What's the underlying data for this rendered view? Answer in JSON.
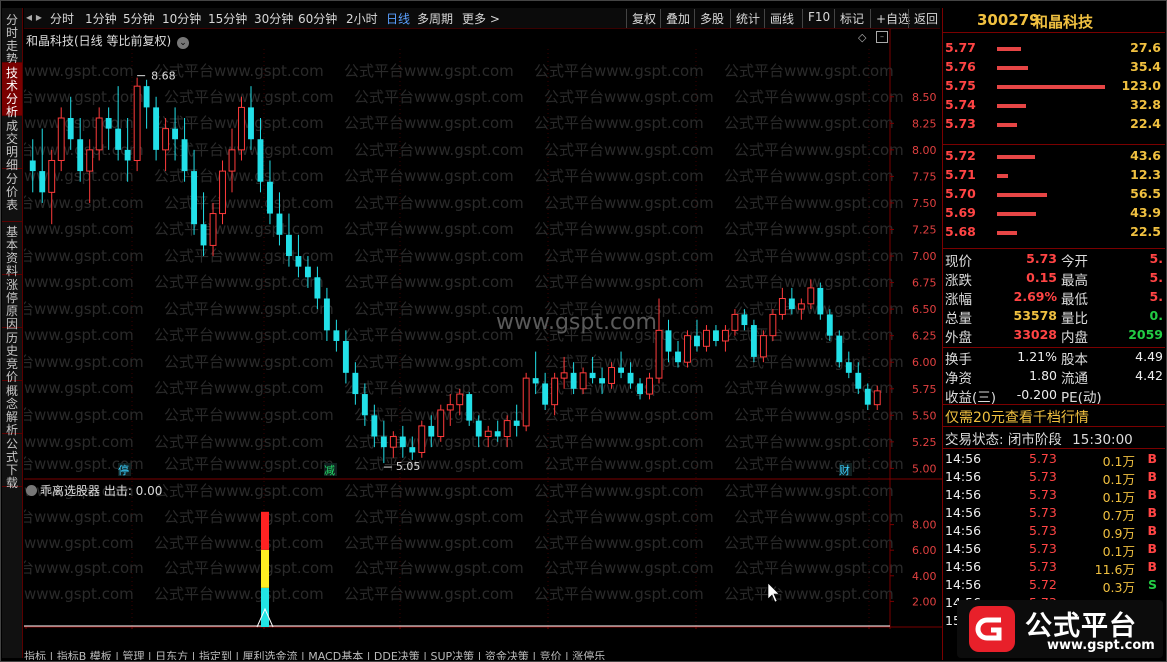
{
  "left_tabs": [
    {
      "label": "分时走势",
      "active": false
    },
    {
      "label": "技术分析",
      "active": true
    },
    {
      "label": "成交明细",
      "active": false
    },
    {
      "label": "分价表",
      "active": false
    },
    {
      "label": "基本资料",
      "active": false
    },
    {
      "label": "涨停原因",
      "active": false
    },
    {
      "label": "历史竞价",
      "active": false
    },
    {
      "label": "概念解析",
      "active": false
    },
    {
      "label": "公式下载",
      "active": false
    }
  ],
  "toolbar": {
    "periods": [
      "分时",
      "1分钟",
      "5分钟",
      "10分钟",
      "15分钟",
      "30分钟",
      "60分钟",
      "2小时",
      "日线",
      "多周期",
      "更多 >"
    ],
    "active_period": "日线",
    "actions": [
      "复权",
      "叠加",
      "多股",
      "统计",
      "画线",
      "F10",
      "标记",
      "+自选",
      "返回"
    ]
  },
  "chart": {
    "title": "和晶科技(日线 等比前复权)",
    "watermark": "www.gspt.com",
    "watermark_repeat": "公式平台www.gspt.com",
    "high_label": "8.68",
    "low_label": "5.05",
    "price_axis": [
      "8.50",
      "8.25",
      "8.00",
      "7.75",
      "7.50",
      "7.25",
      "7.00",
      "6.75",
      "6.50",
      "6.25",
      "6.00",
      "5.75",
      "5.50",
      "5.25",
      "5.00"
    ],
    "events": [
      "停",
      "减",
      "财"
    ],
    "indicator_title": "乖离选股器 出击: 0.00",
    "indicator_axis": [
      "8.00",
      "6.00",
      "4.00",
      "2.00"
    ],
    "date_labels": [
      "2022年",
      "4",
      "5",
      "6",
      "7",
      "8",
      "9"
    ],
    "period_label": "日线"
  },
  "chart_data": {
    "type": "candlestick",
    "title": "和晶科技(日线 等比前复权)",
    "ylim": [
      4.9,
      8.95
    ],
    "high": 8.68,
    "low": 5.05,
    "ohlc": [
      [
        7.9,
        8.1,
        7.6,
        7.8
      ],
      [
        7.8,
        8.2,
        7.5,
        7.6
      ],
      [
        7.6,
        8.0,
        7.3,
        7.9
      ],
      [
        7.9,
        8.4,
        7.8,
        8.3
      ],
      [
        8.3,
        8.5,
        8.0,
        8.1
      ],
      [
        8.1,
        8.3,
        7.7,
        7.8
      ],
      [
        7.8,
        8.1,
        7.5,
        8.0
      ],
      [
        8.0,
        8.4,
        7.9,
        8.3
      ],
      [
        8.3,
        8.4,
        8.0,
        8.2
      ],
      [
        8.2,
        8.6,
        7.9,
        8.0
      ],
      [
        8.0,
        8.3,
        7.7,
        7.9
      ],
      [
        7.9,
        8.68,
        7.8,
        8.6
      ],
      [
        8.6,
        8.66,
        8.2,
        8.4
      ],
      [
        8.4,
        8.5,
        7.9,
        8.0
      ],
      [
        8.0,
        8.3,
        7.8,
        8.2
      ],
      [
        8.2,
        8.4,
        7.9,
        8.1
      ],
      [
        8.1,
        8.3,
        7.7,
        7.8
      ],
      [
        7.8,
        8.0,
        7.2,
        7.3
      ],
      [
        7.3,
        7.6,
        7.0,
        7.1
      ],
      [
        7.1,
        7.5,
        7.0,
        7.4
      ],
      [
        7.4,
        7.9,
        7.3,
        7.8
      ],
      [
        7.8,
        8.2,
        7.6,
        8.0
      ],
      [
        8.0,
        8.5,
        7.9,
        8.4
      ],
      [
        8.4,
        8.6,
        8.0,
        8.1
      ],
      [
        8.1,
        8.3,
        7.6,
        7.7
      ],
      [
        7.7,
        7.9,
        7.3,
        7.4
      ],
      [
        7.4,
        7.6,
        7.1,
        7.2
      ],
      [
        7.2,
        7.4,
        6.9,
        7.0
      ],
      [
        7.0,
        7.2,
        6.8,
        6.9
      ],
      [
        6.9,
        7.0,
        6.7,
        6.8
      ],
      [
        6.8,
        6.9,
        6.5,
        6.6
      ],
      [
        6.6,
        6.7,
        6.2,
        6.3
      ],
      [
        6.3,
        6.4,
        6.1,
        6.2
      ],
      [
        6.2,
        6.3,
        5.8,
        5.9
      ],
      [
        5.9,
        6.0,
        5.6,
        5.7
      ],
      [
        5.7,
        5.8,
        5.4,
        5.5
      ],
      [
        5.5,
        5.6,
        5.2,
        5.3
      ],
      [
        5.3,
        5.45,
        5.05,
        5.2
      ],
      [
        5.2,
        5.35,
        5.1,
        5.3
      ],
      [
        5.3,
        5.4,
        5.1,
        5.2
      ],
      [
        5.2,
        5.3,
        5.08,
        5.15
      ],
      [
        5.15,
        5.45,
        5.1,
        5.4
      ],
      [
        5.4,
        5.5,
        5.2,
        5.3
      ],
      [
        5.3,
        5.6,
        5.25,
        5.55
      ],
      [
        5.55,
        5.7,
        5.4,
        5.6
      ],
      [
        5.6,
        5.75,
        5.5,
        5.7
      ],
      [
        5.7,
        5.72,
        5.4,
        5.45
      ],
      [
        5.45,
        5.5,
        5.2,
        5.3
      ],
      [
        5.3,
        5.4,
        5.2,
        5.35
      ],
      [
        5.35,
        5.45,
        5.25,
        5.3
      ],
      [
        5.3,
        5.5,
        5.2,
        5.45
      ],
      [
        5.45,
        5.6,
        5.3,
        5.4
      ],
      [
        5.4,
        5.9,
        5.35,
        5.85
      ],
      [
        5.85,
        6.1,
        5.7,
        5.8
      ],
      [
        5.8,
        5.9,
        5.55,
        5.6
      ],
      [
        5.6,
        5.9,
        5.5,
        5.85
      ],
      [
        5.85,
        6.05,
        5.75,
        5.9
      ],
      [
        5.9,
        6.0,
        5.7,
        5.75
      ],
      [
        5.75,
        5.95,
        5.7,
        5.9
      ],
      [
        5.9,
        6.05,
        5.8,
        5.85
      ],
      [
        5.85,
        5.95,
        5.7,
        5.8
      ],
      [
        5.8,
        6.0,
        5.75,
        5.95
      ],
      [
        5.95,
        6.1,
        5.85,
        5.9
      ],
      [
        5.9,
        6.0,
        5.75,
        5.8
      ],
      [
        5.8,
        5.85,
        5.65,
        5.7
      ],
      [
        5.7,
        5.9,
        5.65,
        5.85
      ],
      [
        5.85,
        6.6,
        5.8,
        6.3
      ],
      [
        6.3,
        6.4,
        6.0,
        6.1
      ],
      [
        6.1,
        6.2,
        5.95,
        6.0
      ],
      [
        6.0,
        6.3,
        5.95,
        6.25
      ],
      [
        6.25,
        6.4,
        6.1,
        6.15
      ],
      [
        6.15,
        6.35,
        6.1,
        6.3
      ],
      [
        6.3,
        6.35,
        6.15,
        6.2
      ],
      [
        6.2,
        6.35,
        6.1,
        6.3
      ],
      [
        6.3,
        6.5,
        6.25,
        6.45
      ],
      [
        6.45,
        6.5,
        6.3,
        6.35
      ],
      [
        6.35,
        6.4,
        6.0,
        6.05
      ],
      [
        6.05,
        6.3,
        6.0,
        6.25
      ],
      [
        6.25,
        6.5,
        6.2,
        6.45
      ],
      [
        6.45,
        6.7,
        6.4,
        6.6
      ],
      [
        6.6,
        6.7,
        6.45,
        6.5
      ],
      [
        6.5,
        6.6,
        6.4,
        6.55
      ],
      [
        6.55,
        6.78,
        6.5,
        6.7
      ],
      [
        6.7,
        6.75,
        6.4,
        6.45
      ],
      [
        6.45,
        6.5,
        6.2,
        6.25
      ],
      [
        6.25,
        6.3,
        5.95,
        6.0
      ],
      [
        6.0,
        6.1,
        5.85,
        5.9
      ],
      [
        5.9,
        6.0,
        5.7,
        5.75
      ],
      [
        5.75,
        5.8,
        5.55,
        5.6
      ],
      [
        5.6,
        5.78,
        5.55,
        5.73
      ]
    ]
  },
  "indicator_bar": {
    "value": 9.0,
    "segments": [
      {
        "color": "#ff2222",
        "fraction": 0.33
      },
      {
        "color": "#ffee22",
        "fraction": 0.33
      },
      {
        "color": "#22e5e5",
        "fraction": 0.34
      }
    ]
  },
  "stock": {
    "code": "300279",
    "name": "和晶科技"
  },
  "asks": [
    {
      "price": "5.77",
      "vol": "27.6"
    },
    {
      "price": "5.76",
      "vol": "35.4"
    },
    {
      "price": "5.75",
      "vol": "123.0"
    },
    {
      "price": "5.74",
      "vol": "32.8"
    },
    {
      "price": "5.73",
      "vol": "22.4"
    }
  ],
  "bids": [
    {
      "price": "5.72",
      "vol": "43.6"
    },
    {
      "price": "5.71",
      "vol": "12.3"
    },
    {
      "price": "5.70",
      "vol": "56.5"
    },
    {
      "price": "5.69",
      "vol": "43.9"
    },
    {
      "price": "5.68",
      "vol": "22.5"
    }
  ],
  "quote": [
    {
      "l1": "现价",
      "v1": "5.73",
      "c1": "#ff4444",
      "l2": "今开",
      "v2": "5.",
      "c2": "#ff4444"
    },
    {
      "l1": "涨跌",
      "v1": "0.15",
      "c1": "#ff4444",
      "l2": "最高",
      "v2": "5.",
      "c2": "#ff4444"
    },
    {
      "l1": "涨幅",
      "v1": "2.69%",
      "c1": "#ff4444",
      "l2": "最低",
      "v2": "5.",
      "c2": "#ff4444"
    },
    {
      "l1": "总量",
      "v1": "53578",
      "c1": "#f0c040",
      "l2": "量比",
      "v2": "0.",
      "c2": "#22cc44"
    },
    {
      "l1": "外盘",
      "v1": "33028",
      "c1": "#ff4444",
      "l2": "内盘",
      "v2": "2059",
      "c2": "#22cc44"
    }
  ],
  "fundamentals": [
    {
      "l1": "换手",
      "v1": "1.21%",
      "l2": "股本",
      "v2": "4.49"
    },
    {
      "l1": "净资",
      "v1": "1.80",
      "l2": "流通",
      "v2": "4.42"
    },
    {
      "l1": "收益(三)",
      "v1": "-0.200",
      "l2": "PE(动)",
      "v2": ""
    }
  ],
  "promo": "仅需20元查看千档行情",
  "trade_status": {
    "label": "交易状态: 闭市阶段",
    "time": "15:30:00"
  },
  "ticks": [
    {
      "time": "14:56",
      "price": "5.73",
      "vol": "0.1万",
      "bs": "B"
    },
    {
      "time": "14:56",
      "price": "5.73",
      "vol": "0.1万",
      "bs": "B"
    },
    {
      "time": "14:56",
      "price": "5.73",
      "vol": "0.1万",
      "bs": "B"
    },
    {
      "time": "14:56",
      "price": "5.73",
      "vol": "0.7万",
      "bs": "B"
    },
    {
      "time": "14:56",
      "price": "5.73",
      "vol": "0.9万",
      "bs": "B"
    },
    {
      "time": "14:56",
      "price": "5.73",
      "vol": "0.1万",
      "bs": "B"
    },
    {
      "time": "14:56",
      "price": "5.73",
      "vol": "11.6万",
      "bs": "B"
    },
    {
      "time": "14:56",
      "price": "5.72",
      "vol": "0.3万",
      "bs": "S"
    },
    {
      "time": "14:56",
      "price": "5.73",
      "vol": "",
      "bs": ""
    },
    {
      "time": "15:00",
      "price": "",
      "vol": "",
      "bs": ""
    }
  ],
  "logo": {
    "text": "公式平台",
    "url": "www.gspt.com"
  },
  "bottom_tabs": "指标 | 指标B 模板 | 管理 | 日东方 | 指定到 | 厘利选金流 | MACD基本 | DDE决策 | SUP决策 | 资金决策 | 竞价 | 涨停乐"
}
